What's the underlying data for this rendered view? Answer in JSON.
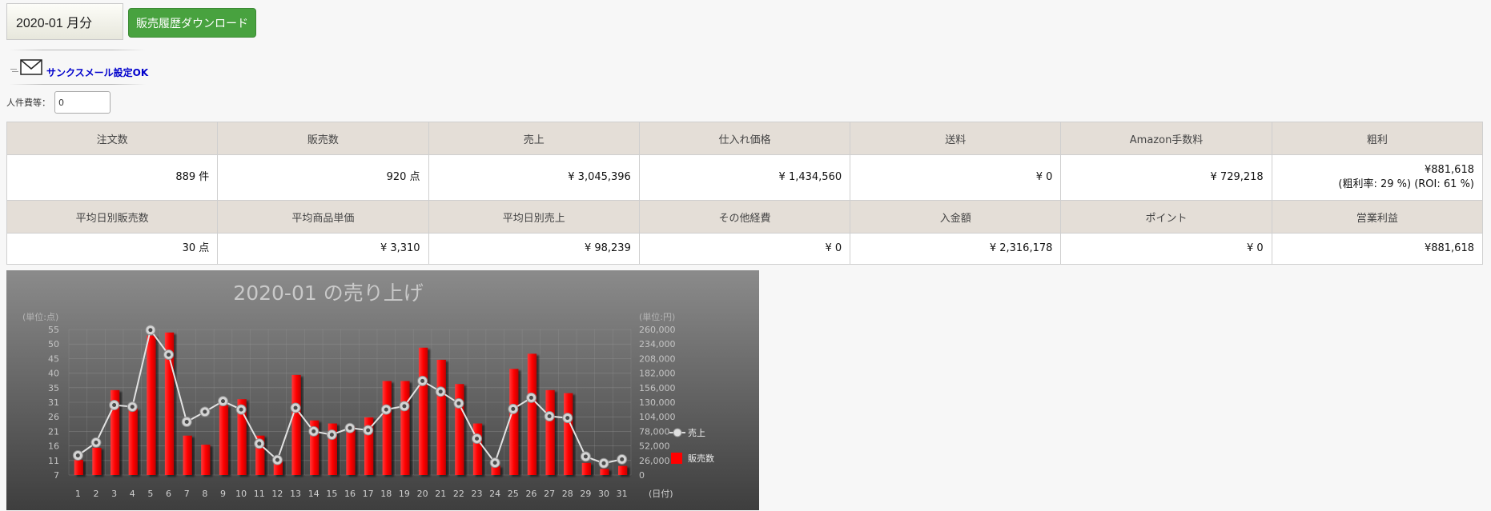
{
  "header": {
    "month_select": "2020-01 月分",
    "download_button": "販売履歴ダウンロード",
    "thanks_mail_link": "サンクスメール設定OK",
    "labor_label": "人件費等：",
    "labor_value": "0"
  },
  "summary": {
    "headers": [
      "注文数",
      "販売数",
      "売上",
      "仕入れ価格",
      "送料",
      "Amazon手数料",
      "粗利"
    ],
    "values": [
      "889 件",
      "920 点",
      "¥ 3,045,396",
      "¥ 1,434,560",
      "¥ 0",
      "¥ 729,218",
      "¥881,618"
    ],
    "profit_rate": "(粗利率: 29 %) (ROI: 61 %)"
  },
  "summary2": {
    "headers": [
      "平均日別販売数",
      "平均商品単価",
      "平均日別売上",
      "その他経費",
      "入金額",
      "ポイント",
      "営業利益"
    ],
    "values": [
      "30 点",
      "¥ 3,310",
      "¥ 98,239",
      "¥ 0",
      "¥ 2,316,178",
      "¥ 0",
      "¥881,618"
    ]
  },
  "colors": {
    "bar": "#ff0000",
    "download_button": "#48a23f",
    "table_header": "#e4ded7",
    "link": "#0000cc"
  },
  "chart_data": {
    "type": "bar",
    "title": "2020-01 の売り上げ",
    "ylabel_left": "(単位:点)",
    "ylabel_right": "(単位:円)",
    "xlabel": "(日付)",
    "x": [
      1,
      2,
      3,
      4,
      5,
      6,
      7,
      8,
      9,
      10,
      11,
      12,
      13,
      14,
      15,
      16,
      17,
      18,
      19,
      20,
      21,
      22,
      23,
      24,
      25,
      26,
      27,
      28,
      29,
      30,
      31
    ],
    "left_ticks": [
      "55",
      "50",
      "45",
      "40",
      "35",
      "31",
      "26",
      "21",
      "16",
      "11",
      "7"
    ],
    "right_ticks": [
      "260,000",
      "234,000",
      "208,000",
      "182,000",
      "156,000",
      "130,000",
      "104,000",
      "78,000",
      "52,000",
      "26,000",
      "0"
    ],
    "ylim_left": [
      7,
      55
    ],
    "ylim_right": [
      0,
      260000
    ],
    "grid": true,
    "legend_position": "right",
    "series": [
      {
        "name": "販売数",
        "type": "bar",
        "axis": "left",
        "values": [
          12,
          16,
          35,
          29,
          53,
          54,
          20,
          17,
          30,
          32,
          20,
          12,
          40,
          25,
          24,
          23,
          26,
          38,
          38,
          49,
          45,
          37,
          24,
          10,
          42,
          47,
          35,
          34,
          11,
          9,
          10
        ]
      },
      {
        "name": "売上",
        "type": "line",
        "axis": "right",
        "values": [
          35000,
          58000,
          125000,
          122000,
          259000,
          215000,
          95000,
          113000,
          132000,
          117000,
          56000,
          27000,
          120000,
          78000,
          72000,
          84000,
          80000,
          117000,
          123000,
          168000,
          149000,
          128000,
          65000,
          22000,
          118000,
          138000,
          105000,
          102000,
          33000,
          21000,
          28000
        ]
      }
    ]
  }
}
